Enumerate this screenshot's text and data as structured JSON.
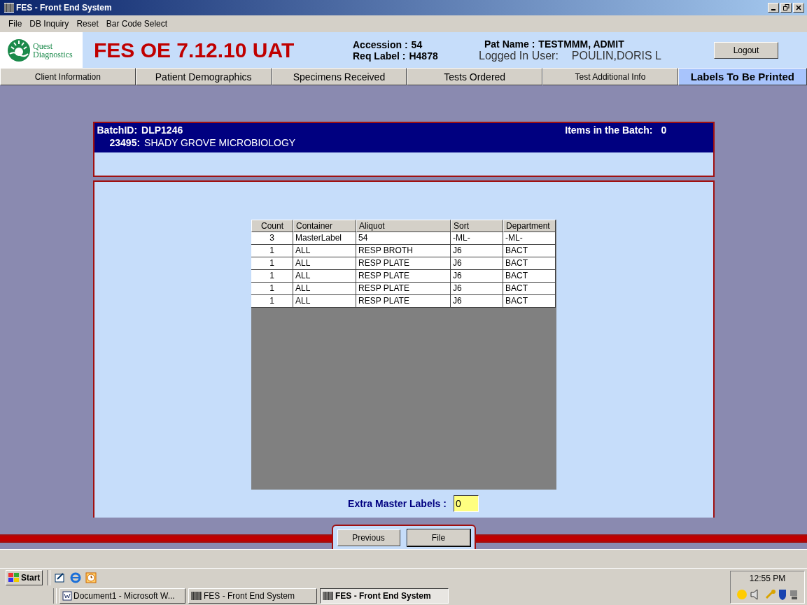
{
  "window": {
    "title": "FES - Front End System"
  },
  "menu": [
    "File",
    "DB Inquiry",
    "Reset",
    "Bar Code Select"
  ],
  "header": {
    "logo_line1": "Quest",
    "logo_line2": "Diagnostics",
    "app_title": "FES OE 7.12.10 UAT",
    "accession_label": "Accession :",
    "accession": "54",
    "req_label": "Req Label :",
    "req": "H4878",
    "pat_label": "Pat Name :",
    "pat_name": "TESTMMM, ADMIT",
    "user_label": "Logged In User:",
    "user": "POULIN,DORIS L",
    "logout": "Logout"
  },
  "tabs": [
    {
      "label": "Client Information",
      "selected": false
    },
    {
      "label": "Patient Demographics",
      "selected": false
    },
    {
      "label": "Specimens Received",
      "selected": false
    },
    {
      "label": "Tests Ordered",
      "selected": false
    },
    {
      "label": "Test Additional Info",
      "selected": false
    },
    {
      "label": "Labels To Be Printed",
      "selected": true
    }
  ],
  "batch": {
    "batch_label": "BatchID:",
    "batch_id": "DLP1246",
    "items_label": "Items in the Batch:",
    "items_count": "0",
    "client_code": "23495:",
    "client_name": "SHADY GROVE MICROBIOLOGY"
  },
  "table": {
    "columns": [
      "Count",
      "Container",
      "Aliquot",
      "Sort",
      "Department"
    ],
    "rows": [
      [
        "3",
        "MasterLabel",
        "54",
        "-ML-",
        "-ML-"
      ],
      [
        "1",
        "ALL",
        "RESP BROTH",
        "J6",
        "BACT"
      ],
      [
        "1",
        "ALL",
        "RESP PLATE",
        "J6",
        "BACT"
      ],
      [
        "1",
        "ALL",
        "RESP PLATE",
        "J6",
        "BACT"
      ],
      [
        "1",
        "ALL",
        "RESP PLATE",
        "J6",
        "BACT"
      ],
      [
        "1",
        "ALL",
        "RESP PLATE",
        "J6",
        "BACT"
      ]
    ]
  },
  "extra_master_labels": {
    "label": "Extra Master Labels :",
    "value": "0"
  },
  "buttons": [
    "Previous",
    "File"
  ],
  "taskbar": {
    "start": "Start",
    "tasks": [
      {
        "label": "Document1 - Microsoft W...",
        "selected": false
      },
      {
        "label": "FES - Front End System",
        "selected": false
      },
      {
        "label": "FES - Front End System",
        "selected": true
      }
    ],
    "clock": "12:55 PM"
  }
}
